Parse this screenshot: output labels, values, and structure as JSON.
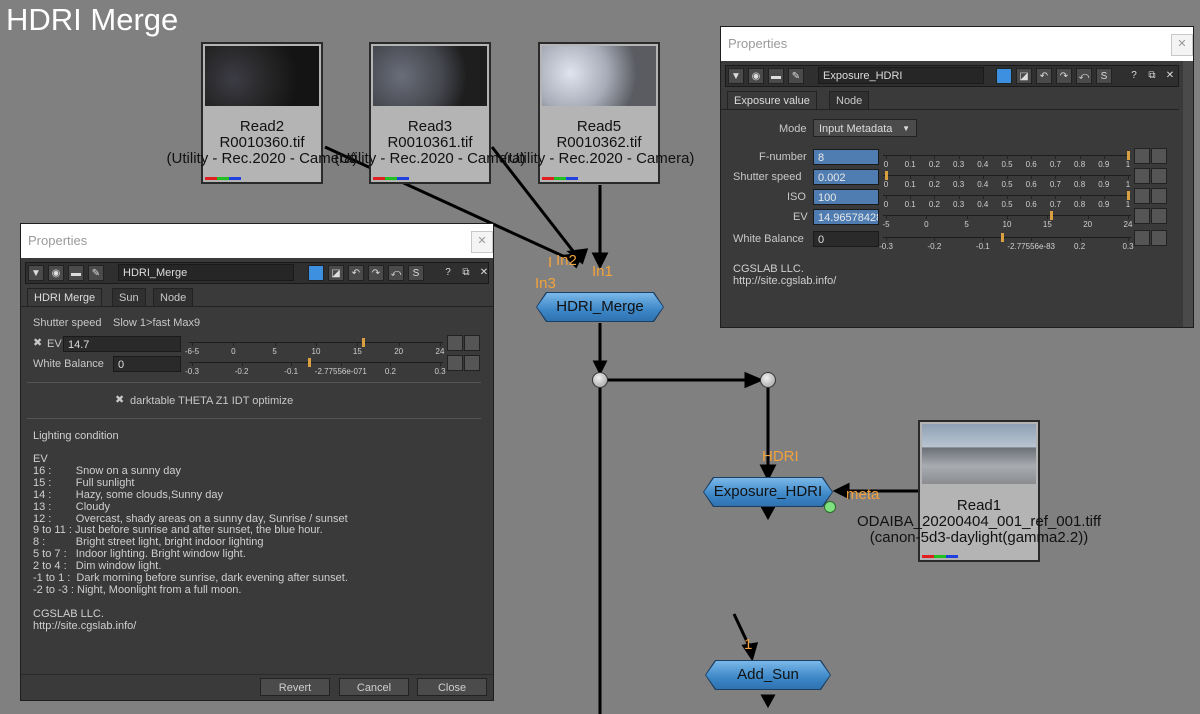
{
  "graph": {
    "title": "HDRI Merge",
    "read_nodes": [
      {
        "name": "Read2",
        "file": "R0010360.tif",
        "colorspace": "(Utility - Rec.2020 - Camera)"
      },
      {
        "name": "Read3",
        "file": "R0010361.tif",
        "colorspace": "(Utility - Rec.2020 - Camera)"
      },
      {
        "name": "Read5",
        "file": "R0010362.tif",
        "colorspace": "(Utility - Rec.2020 - Camera)"
      },
      {
        "name": "Read1",
        "file": "ODAIBA_20200404_001_ref_001.tiff",
        "colorspace": "(canon-5d3-daylight(gamma2.2))"
      }
    ],
    "nodes": {
      "hdri_merge": "HDRI_Merge",
      "exposure_hdri": "Exposure_HDRI",
      "add_sun": "Add_Sun"
    },
    "input_labels": {
      "in1": "In1",
      "in2": "In2",
      "in3": "In3",
      "hdri": "HDRI",
      "meta": "meta",
      "one": "1"
    }
  },
  "left_panel": {
    "title": "Properties",
    "node_name": "HDRI_Merge",
    "tabs": [
      "HDRI Merge",
      "Sun",
      "Node"
    ],
    "shutter_label": "Shutter speed",
    "shutter_value": "Slow 1>fast Max9",
    "ev_label": "EV",
    "ev_value": "14.7",
    "ev_ticks": [
      "-6-5",
      "0",
      "5",
      "10",
      "15",
      "20",
      "24"
    ],
    "ev_fraction": 0.69,
    "wb_label": "White Balance",
    "wb_value": "0",
    "wb_ticks": [
      "-0.3",
      "-0.2",
      "-0.1",
      "-2.77556e-071",
      "0.2",
      "0.3"
    ],
    "wb_fraction": 0.47,
    "checkbox_label": "darktable THETA Z1 IDT optimize",
    "checkbox_mark": "✖",
    "lighting_title": "Lighting condition",
    "lighting_lines": [
      "EV",
      "16 :        Snow on a sunny day",
      "15 :        Full sunlight",
      "14 :        Hazy, some clouds,Sunny day",
      "13 :        Cloudy",
      "12 :        Overcast, shady areas on a sunny day, Sunrise / sunset",
      "9 to 11 : Just before sunrise and after sunset, the blue hour.",
      "8 :          Bright street light, bright indoor lighting",
      "5 to 7 :   Indoor lighting. Bright window light.",
      "2 to 4 :   Dim window light.",
      "-1 to 1 :  Dark morning before sunrise, dark evening after sunset.",
      "-2 to -3 : Night, Moonlight from a full moon.",
      "",
      "CGSLAB LLC.",
      "http://site.cgslab.info/"
    ],
    "buttons": {
      "revert": "Revert",
      "cancel": "Cancel",
      "close": "Close"
    }
  },
  "right_panel": {
    "title": "Properties",
    "node_name": "Exposure_HDRI",
    "tabs": [
      "Exposure value",
      "Node"
    ],
    "mode_label": "Mode",
    "mode_value": "Input Metadata",
    "fnumber_label": "F-number",
    "fnumber_value": "8",
    "shutter_label": "Shutter speed",
    "shutter_value": "0.002",
    "iso_label": "ISO",
    "iso_value": "100",
    "ev_label": "EV",
    "ev_value": "14.96578428",
    "wb_label": "White Balance",
    "wb_value": "0",
    "unit_ticks": [
      "0",
      "0.1",
      "0.2",
      "0.3",
      "0.4",
      "0.5",
      "0.6",
      "0.7",
      "0.8",
      "0.9",
      "1"
    ],
    "ev_ticks": [
      "-5",
      "0",
      "5",
      "10",
      "15",
      "20",
      "24"
    ],
    "ev_fraction": 0.68,
    "wb_ticks": [
      "-0.3",
      "-0.2",
      "-0.1",
      "-2.77556e-83",
      "0.2",
      "0.3"
    ],
    "wb_fraction": 0.48,
    "footer": [
      "CGSLAB LLC.",
      "http://site.cgslab.info/"
    ]
  },
  "colors": {
    "accent": "#d8a040",
    "node_blue": "#4a95d4",
    "input_label": "#f2a23c"
  }
}
